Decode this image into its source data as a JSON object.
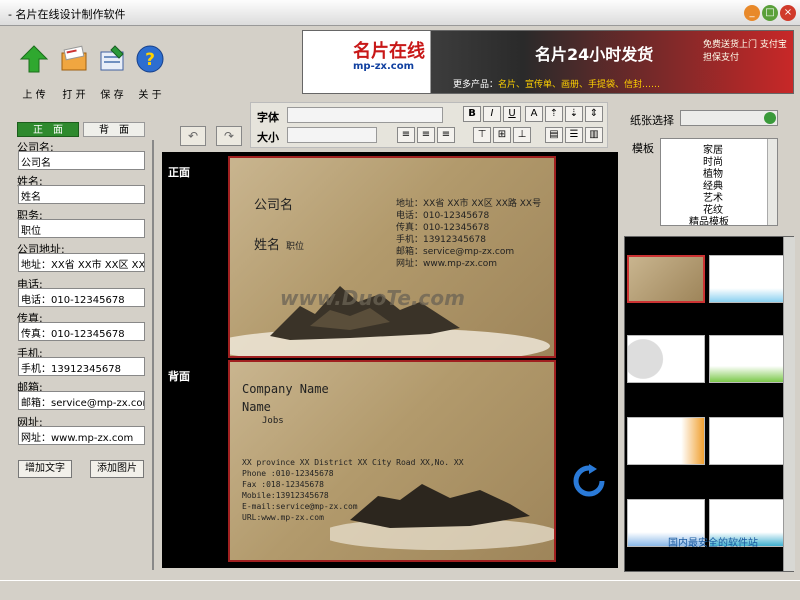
{
  "window": {
    "title": "- 名片在线设计制作软件"
  },
  "toolbar": {
    "upload": "上 传",
    "open": "打 开",
    "save": "保 存",
    "about": "关 于"
  },
  "banner": {
    "logo": "名片在线",
    "logo_sub": "mp-zx.com",
    "slogan": "名片24小时发货",
    "side_text": "免费送货上门 支付宝担保支付",
    "more_label": "更多产品：",
    "more_items": "名片、宣传单、画册、手提袋、信封……"
  },
  "font_panel": {
    "font_label": "字体",
    "size_label": "大小",
    "bold": "B",
    "italic": "I",
    "underline": "U"
  },
  "left_panel": {
    "tab_front": "正　面",
    "tab_back": "背　面",
    "fields": [
      {
        "label": "公司名:",
        "value": "公司名"
      },
      {
        "label": "姓名:",
        "value": "姓名"
      },
      {
        "label": "职务:",
        "value": "职位"
      },
      {
        "label": "公司地址:",
        "value": "地址：XX省 XX市 XX区 XX"
      },
      {
        "label": "电话:",
        "value": "电话：010-12345678"
      },
      {
        "label": "传真:",
        "value": "传真：010-12345678"
      },
      {
        "label": "手机:",
        "value": "手机：13912345678"
      },
      {
        "label": "邮箱:",
        "value": "邮箱：service@mp-zx.com"
      },
      {
        "label": "网址:",
        "value": "网址：www.mp-zx.com"
      }
    ],
    "add_text": "增加文字",
    "add_image": "添加图片"
  },
  "canvas": {
    "front_label": "正面",
    "back_label": "背面",
    "front": {
      "company": "公司名",
      "name": "姓名",
      "position": "职位",
      "lines": [
        "地址：XX省 XX市 XX区 XX路 XX号",
        "电话：010-12345678",
        "传真：010-12345678",
        "手机：13912345678",
        "邮箱：service@mp-zx.com",
        "网址：www.mp-zx.com"
      ],
      "watermark": "www.DuoTe.com"
    },
    "back": {
      "company": "Company Name",
      "name": "Name",
      "jobs": "Jobs",
      "lines": [
        "XX province XX District XX City Road XX,No. XX",
        "Phone :010-12345678",
        "Fax :018-12345678",
        "Mobile:13912345678",
        "E-mail:service@mp-zx.com",
        "URL:www.mp-zx.com"
      ]
    }
  },
  "right_panel": {
    "paper_label": "纸张选择",
    "template_label": "模板",
    "tree_items": [
      "家居",
      "时尚",
      "植物",
      "经典",
      "艺术",
      "花纹",
      "精品模板"
    ]
  },
  "watermark_site": "国内最安全的软件站",
  "colors": {
    "accent_green": "#2e8a2e",
    "card_border": "#a02020",
    "banner_red": "#c82828"
  }
}
